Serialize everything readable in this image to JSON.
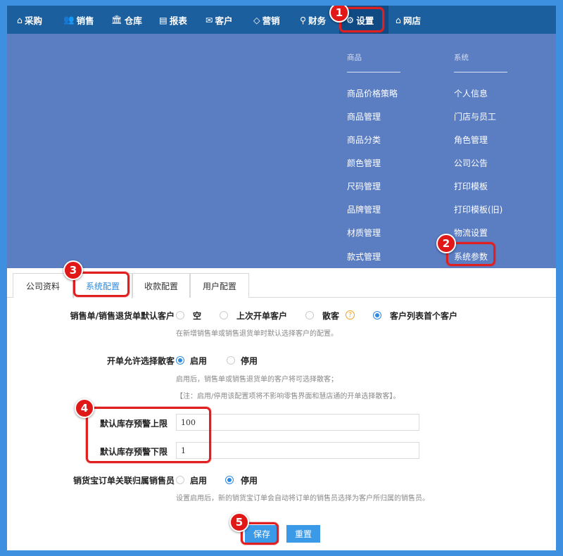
{
  "nav": {
    "items": [
      {
        "icon": "⌂",
        "label": "采购"
      },
      {
        "icon": "👥",
        "label": "销售"
      },
      {
        "icon": "🏛",
        "label": "仓库"
      },
      {
        "icon": "▤",
        "label": "报表"
      },
      {
        "icon": "✉",
        "label": "客户"
      },
      {
        "icon": "◇",
        "label": "营销"
      },
      {
        "icon": "⚲",
        "label": "财务"
      },
      {
        "icon": "⚙",
        "label": "设置"
      },
      {
        "icon": "⌂",
        "label": "网店"
      }
    ]
  },
  "dropdown": {
    "col1": {
      "header": "商品",
      "items": [
        "商品价格策略",
        "商品管理",
        "商品分类",
        "颜色管理",
        "尺码管理",
        "品牌管理",
        "材质管理",
        "款式管理"
      ]
    },
    "col2": {
      "header": "系统",
      "items": [
        "个人信息",
        "门店与员工",
        "角色管理",
        "公司公告",
        "打印模板",
        "打印模板(旧)",
        "物流设置",
        "系统参数"
      ]
    }
  },
  "tabs": [
    "公司资料",
    "系统配置",
    "收款配置",
    "用户配置"
  ],
  "form": {
    "default_customer": {
      "label": "销售单/销售退货单默认客户",
      "options": [
        "空",
        "上次开单客户",
        "散客",
        "客户列表首个客户"
      ],
      "help": "?",
      "hint": "在新增销售单或销售退货单时默认选择客户的配置。"
    },
    "allow_walkin": {
      "label": "开单允许选择散客",
      "options": [
        "启用",
        "停用"
      ],
      "hint1": "启用后，销售单或销售退货单的客户将可选择散客；",
      "hint2": "【注：启用/停用该配置项将不影响零售界面和慧店通的开单选择散客】。"
    },
    "stock_upper": {
      "label": "默认库存预警上限",
      "value": "100"
    },
    "stock_lower": {
      "label": "默认库存预警下限",
      "value": "1"
    },
    "salesperson": {
      "label": "销货宝订单关联归属销售员",
      "options": [
        "启用",
        "停用"
      ],
      "hint": "设置启用后，新的销货宝订单会自动将订单的销售员选择为客户所归属的销售员。"
    },
    "save": "保存",
    "reset": "重置"
  },
  "annotations": [
    "1",
    "2",
    "3",
    "4",
    "5"
  ],
  "colors": {
    "nav": "#1c5f9e",
    "dropdown": "#5b7dc2",
    "accent": "#2d8ae0",
    "marker": "#e01818"
  }
}
